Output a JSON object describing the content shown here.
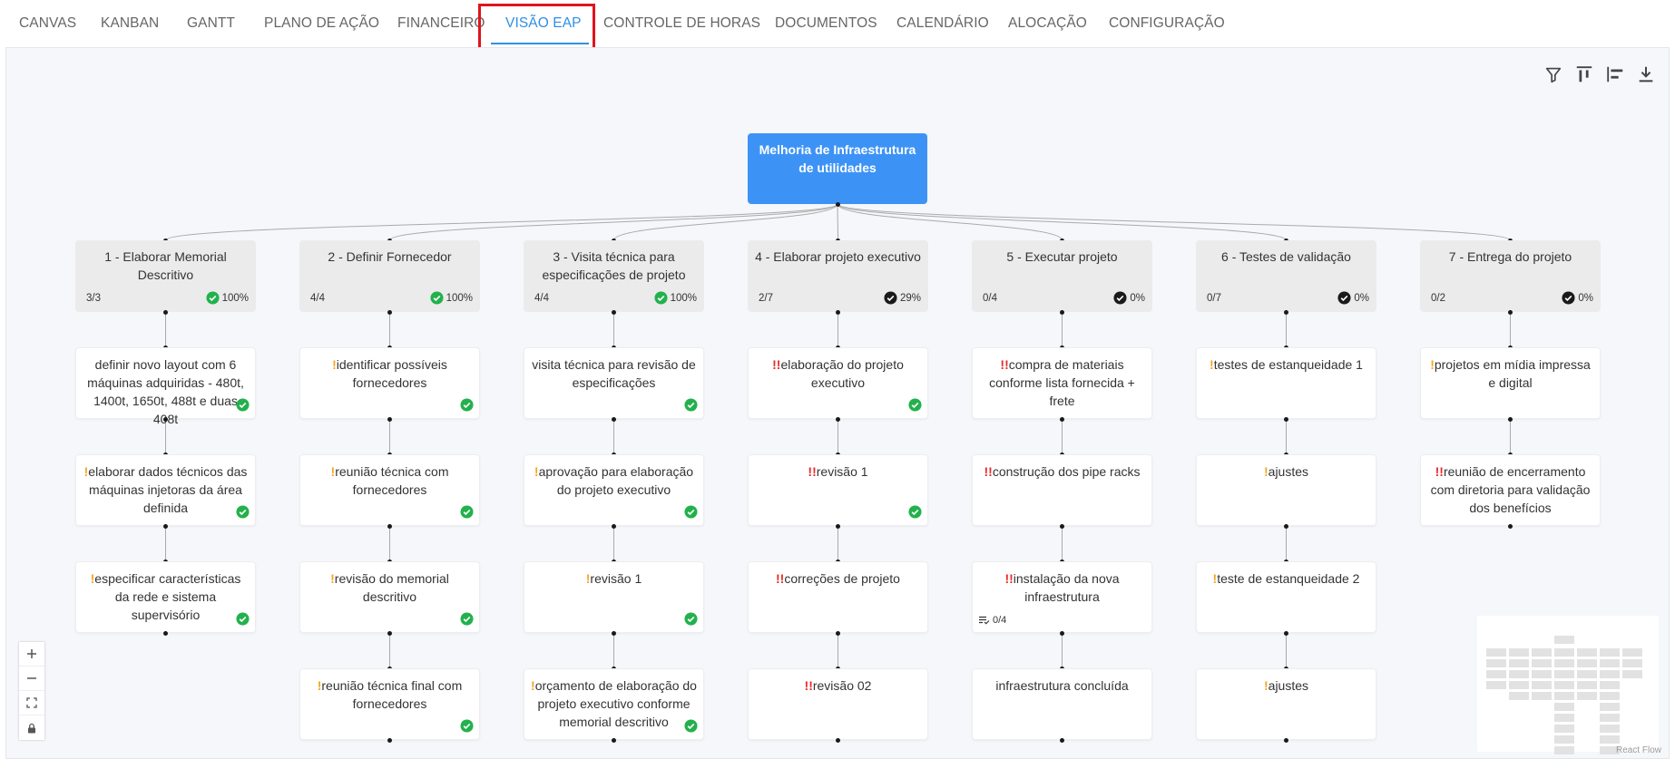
{
  "tabs": [
    {
      "label": "CANVAS",
      "active": false
    },
    {
      "label": "KANBAN",
      "active": false
    },
    {
      "label": "GANTT",
      "active": false
    },
    {
      "label": "PLANO DE AÇÃO",
      "active": false
    },
    {
      "label": "FINANCEIRO",
      "active": false
    },
    {
      "label": "VISÃO EAP",
      "active": true
    },
    {
      "label": "CONTROLE DE HORAS",
      "active": false
    },
    {
      "label": "DOCUMENTOS",
      "active": false
    },
    {
      "label": "CALENDÁRIO",
      "active": false
    },
    {
      "label": "ALOCAÇÃO",
      "active": false
    },
    {
      "label": "CONFIGURAÇÃO",
      "active": false
    }
  ],
  "toolbar": {
    "icons": [
      "filter-icon",
      "align-top-icon",
      "align-left-icon",
      "download-icon"
    ]
  },
  "root": {
    "title": "Melhoria de Infraestrutura de utilidades"
  },
  "phases": [
    {
      "title": "1 - Elaborar Memorial Descritivo",
      "count": "3/3",
      "percent": "100%",
      "complete": true,
      "tasks": [
        {
          "priority": "",
          "text": "definir novo layout com 6 máquinas adquiridas - 480t, 1400t, 1650t, 488t e duas 408t",
          "done": true,
          "subtasks": ""
        },
        {
          "priority": "!",
          "text": "elaborar dados técnicos das máquinas injetoras da área definida",
          "done": true,
          "subtasks": ""
        },
        {
          "priority": "!",
          "text": "especificar características da rede e sistema supervisório",
          "done": true,
          "subtasks": ""
        }
      ]
    },
    {
      "title": "2 - Definir Fornecedor",
      "count": "4/4",
      "percent": "100%",
      "complete": true,
      "tasks": [
        {
          "priority": "!",
          "text": "identificar possíveis fornecedores",
          "done": true,
          "subtasks": ""
        },
        {
          "priority": "!",
          "text": "reunião técnica com fornecedores",
          "done": true,
          "subtasks": ""
        },
        {
          "priority": "!",
          "text": "revisão do memorial descritivo",
          "done": true,
          "subtasks": ""
        },
        {
          "priority": "!",
          "text": "reunião técnica final com fornecedores",
          "done": true,
          "subtasks": ""
        }
      ]
    },
    {
      "title": "3 - Visita técnica para especificações de projeto",
      "count": "4/4",
      "percent": "100%",
      "complete": true,
      "tasks": [
        {
          "priority": "",
          "text": "visita técnica para revisão de especificações",
          "done": true,
          "subtasks": ""
        },
        {
          "priority": "!",
          "text": "aprovação para elaboração do projeto executivo",
          "done": true,
          "subtasks": ""
        },
        {
          "priority": "!",
          "text": "revisão 1",
          "done": true,
          "subtasks": ""
        },
        {
          "priority": "!",
          "text": "orçamento de elaboração do projeto executivo conforme memorial descritivo",
          "done": true,
          "subtasks": ""
        }
      ]
    },
    {
      "title": "4 - Elaborar projeto executivo",
      "count": "2/7",
      "percent": "29%",
      "complete": false,
      "tasks": [
        {
          "priority": "!!",
          "text": "elaboração do projeto executivo",
          "done": true,
          "subtasks": ""
        },
        {
          "priority": "!!",
          "text": "revisão 1",
          "done": true,
          "subtasks": ""
        },
        {
          "priority": "!!",
          "text": "correções de projeto",
          "done": false,
          "subtasks": ""
        },
        {
          "priority": "!!",
          "text": "revisão 02",
          "done": false,
          "subtasks": ""
        }
      ]
    },
    {
      "title": "5 - Executar projeto",
      "count": "0/4",
      "percent": "0%",
      "complete": false,
      "tasks": [
        {
          "priority": "!!",
          "text": "compra de materiais conforme lista fornecida + frete",
          "done": false,
          "subtasks": ""
        },
        {
          "priority": "!!",
          "text": "construção dos pipe racks",
          "done": false,
          "subtasks": ""
        },
        {
          "priority": "!!",
          "text": "instalação da nova infraestrutura",
          "done": false,
          "subtasks": "0/4"
        },
        {
          "priority": "",
          "text": "infraestrutura concluída",
          "done": false,
          "subtasks": ""
        }
      ]
    },
    {
      "title": "6 - Testes de validação",
      "count": "0/7",
      "percent": "0%",
      "complete": false,
      "tasks": [
        {
          "priority": "!",
          "text": "testes de estanqueidade 1",
          "done": false,
          "subtasks": ""
        },
        {
          "priority": "!",
          "text": "ajustes",
          "done": false,
          "subtasks": ""
        },
        {
          "priority": "!",
          "text": "teste de estanqueidade 2",
          "done": false,
          "subtasks": ""
        },
        {
          "priority": "!",
          "text": "ajustes",
          "done": false,
          "subtasks": ""
        }
      ]
    },
    {
      "title": "7 - Entrega do projeto",
      "count": "0/2",
      "percent": "0%",
      "complete": false,
      "tasks": [
        {
          "priority": "!",
          "text": "projetos em mídia impressa e digital",
          "done": false,
          "subtasks": ""
        },
        {
          "priority": "!!",
          "text": "reunião de encerramento com diretoria para validação dos benefícios",
          "done": false,
          "subtasks": ""
        }
      ]
    }
  ],
  "controls": [
    "zoom-in-icon",
    "zoom-out-icon",
    "fit-view-icon",
    "lock-icon"
  ],
  "attribution": "React Flow",
  "colors": {
    "accent": "#2f8fe6",
    "root": "#3d93f5",
    "done": "#22b14c",
    "prio_low": "#f5a623",
    "prio_high": "#e82c2c",
    "highlight": "#e0141c"
  }
}
